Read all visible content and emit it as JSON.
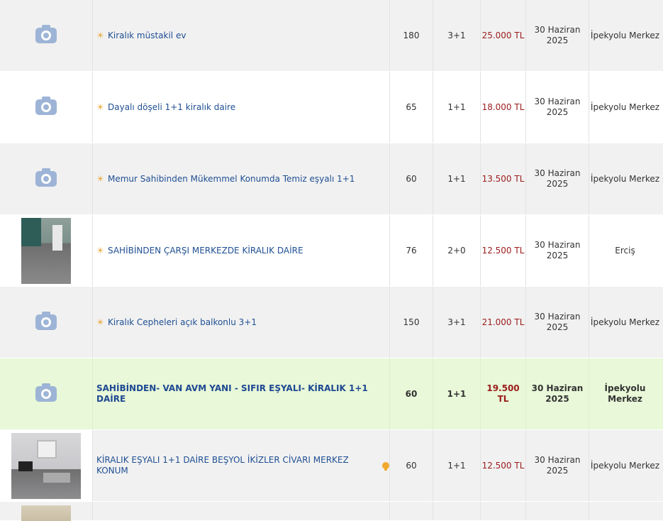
{
  "listings": [
    {
      "title": "Kiralık müstakil ev",
      "m2": "180",
      "rooms": "3+1",
      "price": "25.000 TL",
      "date": "30 Haziran 2025",
      "location": "İpekyolu Merkez",
      "star": "☀",
      "thumb": "camera-icon"
    },
    {
      "title": "Dayalı döşeli 1+1 kiralık daire",
      "m2": "65",
      "rooms": "1+1",
      "price": "18.000 TL",
      "date": "30 Haziran 2025",
      "location": "İpekyolu Merkez",
      "star": "☀",
      "thumb": "camera-icon"
    },
    {
      "title": "Memur Sahibinden Mükemmel Konumda Temiz eşyalı 1+1",
      "m2": "60",
      "rooms": "1+1",
      "price": "13.500 TL",
      "date": "30 Haziran 2025",
      "location": "İpekyolu Merkez",
      "star": "☀",
      "thumb": "camera-icon"
    },
    {
      "title": "SAHİBİNDEN ÇARŞI MERKEZDE KİRALIK DAİRE",
      "m2": "76",
      "rooms": "2+0",
      "price": "12.500 TL",
      "date": "30 Haziran 2025",
      "location": "Erciş",
      "star": "☀",
      "thumb": "photo"
    },
    {
      "title": "Kiralık Cepheleri açık balkonlu 3+1",
      "m2": "150",
      "rooms": "3+1",
      "price": "21.000 TL",
      "date": "30 Haziran 2025",
      "location": "İpekyolu Merkez",
      "star": "☀",
      "thumb": "camera-icon"
    },
    {
      "title": "SAHİBİNDEN- VAN AVM YANI - SIFIR EŞYALI- KİRALIK 1+1 DAİRE",
      "m2": "60",
      "rooms": "1+1",
      "price": "19.500 TL",
      "date": "30 Haziran 2025",
      "location": "İpekyolu Merkez",
      "star": "",
      "thumb": "camera-icon",
      "highlighted": true
    },
    {
      "title": "KİRALIK EŞYALI 1+1 DAİRE BEŞYOL İKİZLER CİVARI MERKEZ KONUM",
      "m2": "60",
      "rooms": "1+1",
      "price": "12.500 TL",
      "date": "30 Haziran 2025",
      "location": "İpekyolu Merkez",
      "star": "",
      "thumb": "photo",
      "pin_icon": "map-pin-icon"
    }
  ]
}
